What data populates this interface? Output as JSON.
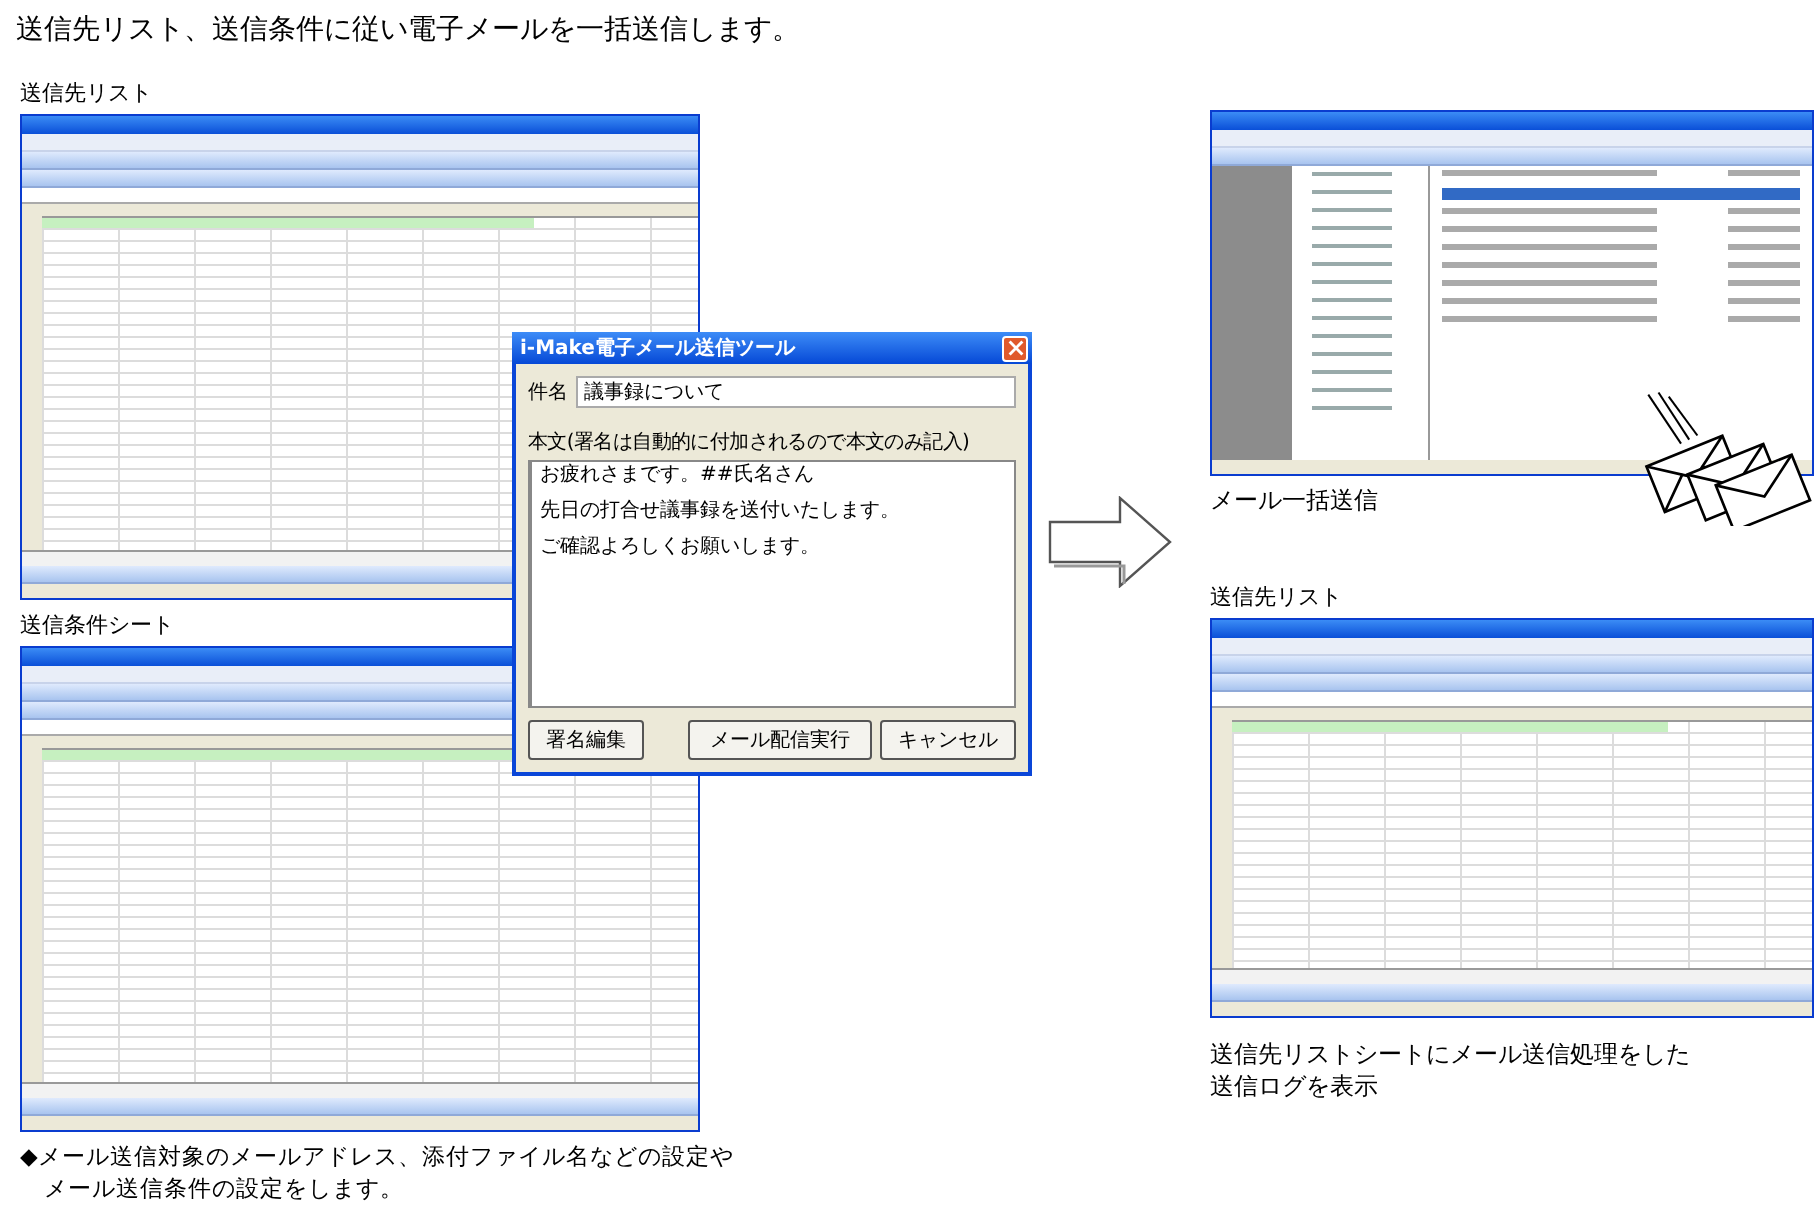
{
  "heading": "送信先リスト、送信条件に従い電子メールを一括送信します。",
  "panels": [
    {
      "kind": "spreadsheet",
      "label": "送信先リスト"
    },
    {
      "kind": "spreadsheet",
      "label": "送信条件シート",
      "captions": [
        "◆メール送信対象のメールアドレス、添付ファイル名などの設定や",
        "メール送信条件の設定をします。"
      ]
    },
    {
      "kind": "mail-client",
      "captions": [
        "メール一括送信"
      ]
    },
    {
      "kind": "spreadsheet",
      "label": "送信先リスト",
      "captions": [
        "送信先リストシートにメール送信処理をした",
        "送信ログを表示"
      ]
    }
  ],
  "dialog": {
    "title": "i-Make電子メール送信ツール",
    "subject_label": "件名",
    "subject": "議事録について",
    "body_label": "本文(署名は自動的に付加されるので本文のみ記入)",
    "body_lines": [
      "お疲れさまです。##氏名さん",
      "先日の打合せ議事録を送付いたします。",
      "ご確認よろしくお願いします。"
    ],
    "buttons": [
      "署名編集",
      "メール配信実行",
      "キャンセル"
    ]
  }
}
